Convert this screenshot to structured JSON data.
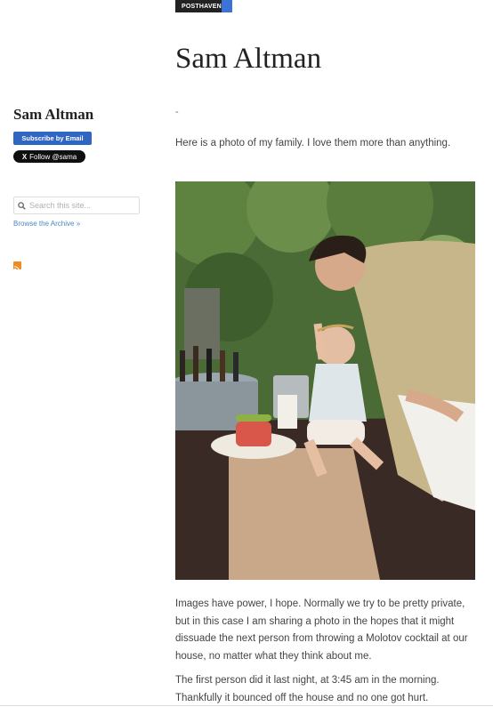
{
  "badge": {
    "label": "POSTHAVEN"
  },
  "sidebar": {
    "title": "Sam Altman",
    "subscribe_label": "Subscribe by Email",
    "follow_label": "Follow @sama",
    "follow_icon": "X",
    "search_placeholder": "Search this site...",
    "browse_label": "Browse the Archive »",
    "rss_icon": "rss-icon"
  },
  "post": {
    "title": "Sam Altman",
    "dash": "-",
    "intro": "Here is a photo of my family. I love them more than anything.",
    "paragraph1": "Images have power, I hope. Normally we try to be pretty private, but in this case I am sharing a photo in the hopes that it might dissuade the next person from throwing a Molotov cocktail at our house, no matter what they think about me.",
    "paragraph2": "The first person did it last night, at 3:45 am in the morning. Thankfully it bounced off the house and no one got hurt."
  },
  "colors": {
    "accent_blue": "#2f66c4",
    "link_blue": "#4a86c7",
    "rss_orange": "#f08a24"
  }
}
